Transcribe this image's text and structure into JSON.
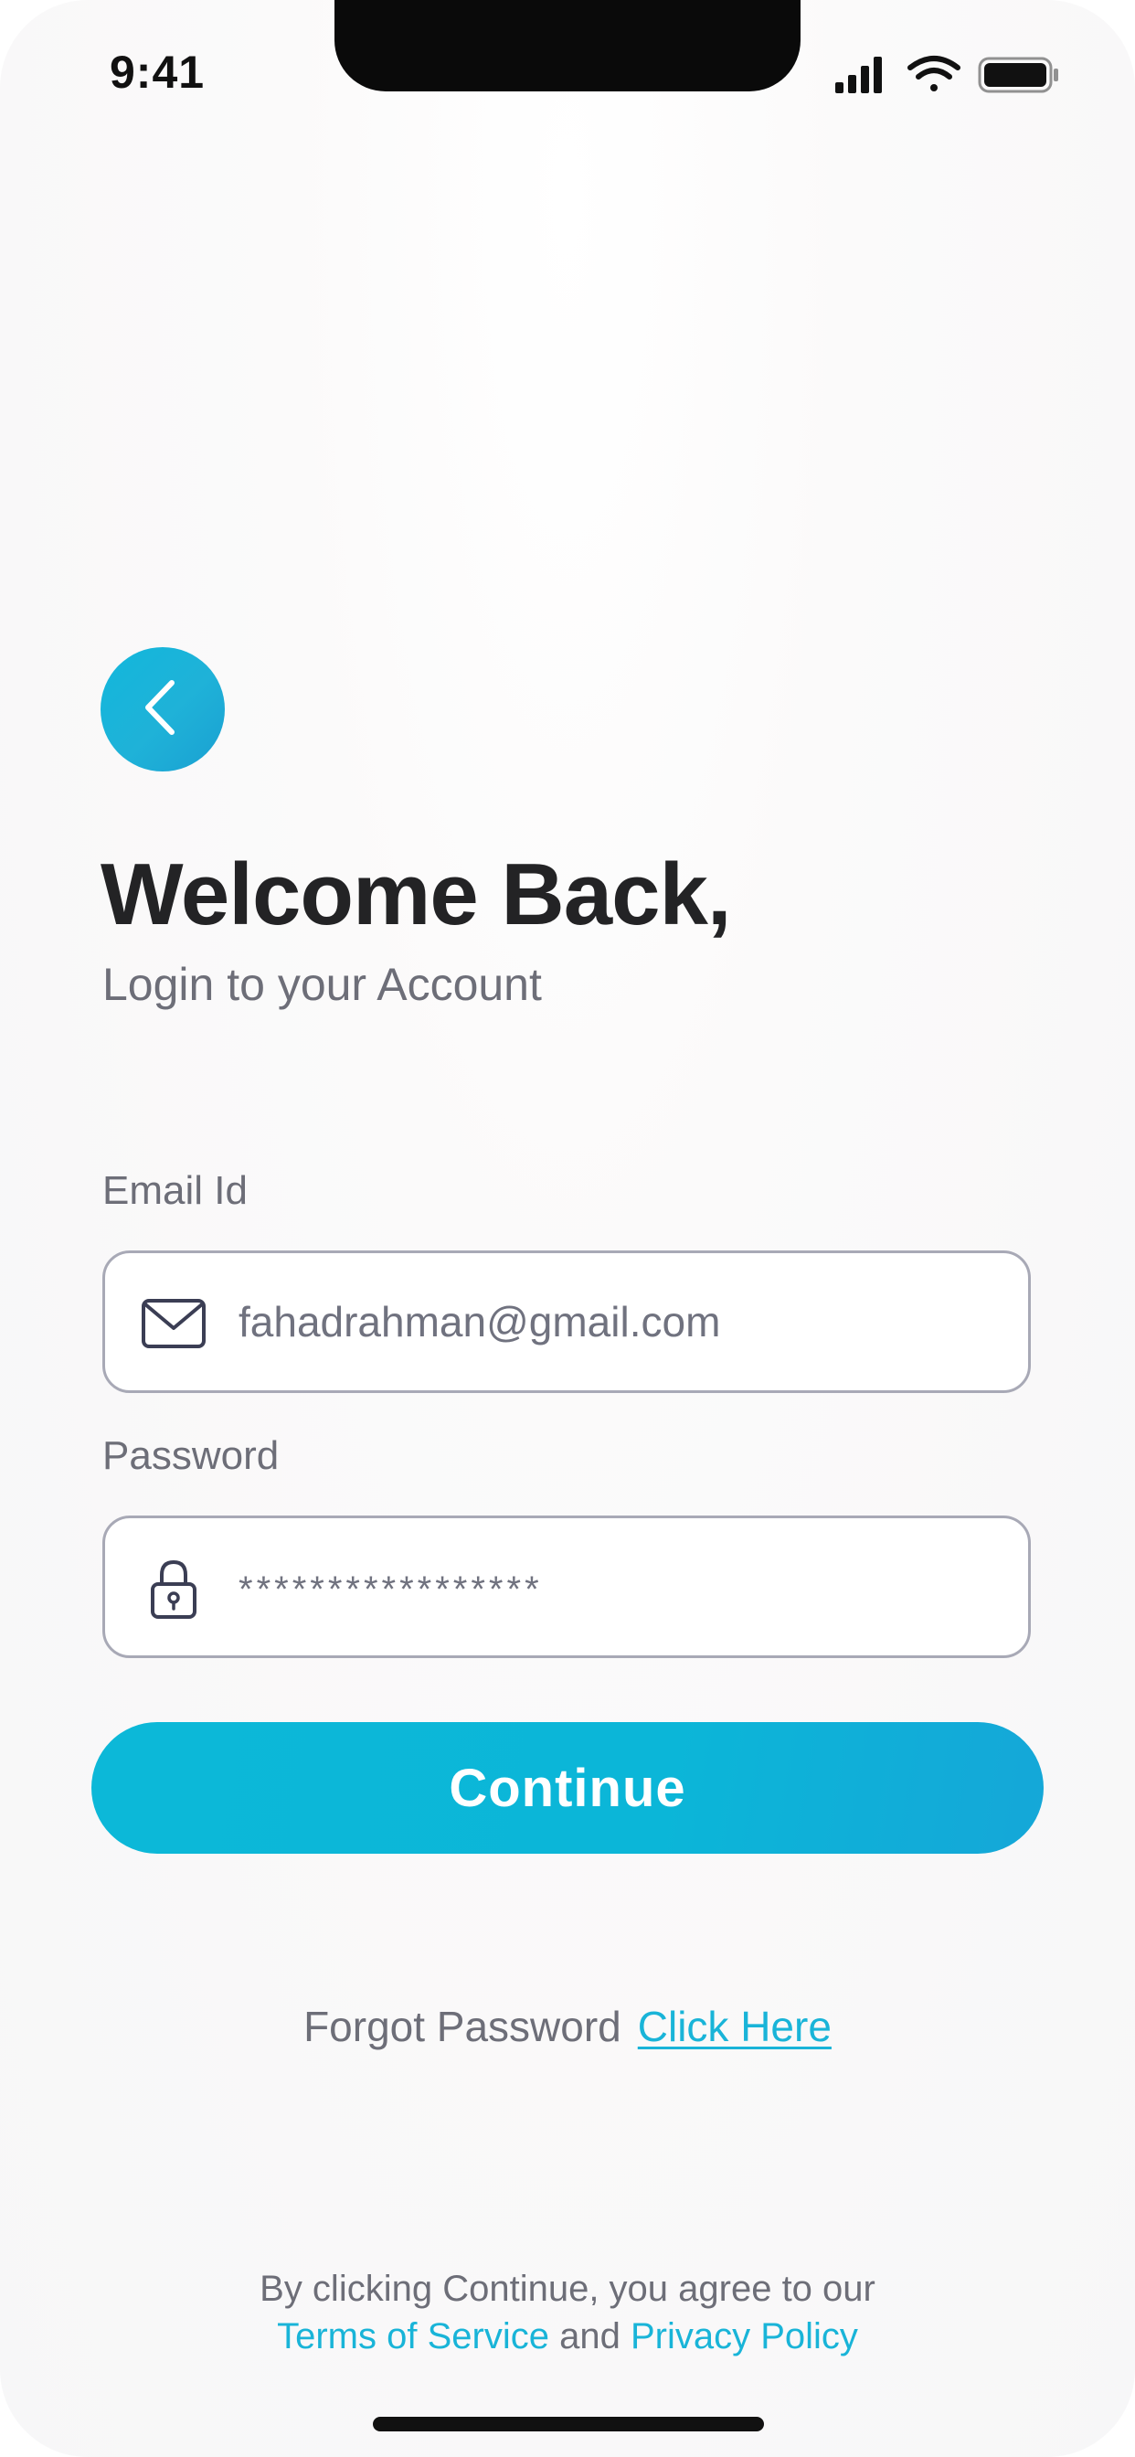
{
  "status_bar": {
    "time": "9:41",
    "icons": [
      "cellular-signal-icon",
      "wifi-icon",
      "battery-icon"
    ]
  },
  "back_button": {
    "icon": "chevron-left-icon"
  },
  "header": {
    "title": "Welcome Back,",
    "subtitle": "Login to your Account"
  },
  "form": {
    "email": {
      "label": "Email Id",
      "value": "fahadrahman@gmail.com",
      "icon": "envelope-icon"
    },
    "password": {
      "label": "Password",
      "value": "*****************",
      "icon": "lock-icon"
    },
    "submit_label": "Continue"
  },
  "forgot": {
    "text": "Forgot Password",
    "link_label": "Click Here"
  },
  "legal": {
    "line1": "By clicking Continue, you agree to our",
    "terms_label": "Terms of Service",
    "and": "and",
    "privacy_label": "Privacy Policy"
  },
  "colors": {
    "accent": "#12B6D9",
    "title": "#232325",
    "muted": "#6D6E78",
    "field_border": "#A8A9B6"
  }
}
